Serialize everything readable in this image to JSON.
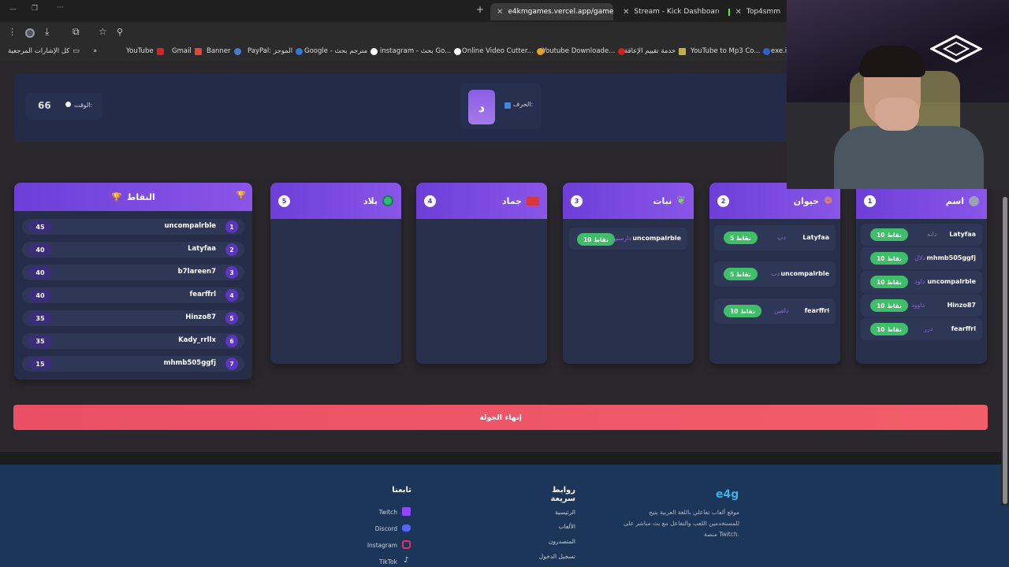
{
  "browser": {
    "tabs": [
      {
        "title": "e4kmgames.vercel.app/games/",
        "active": true
      },
      {
        "title": "Stream - Kick Dashboard",
        "active": false
      },
      {
        "title": "Top4smm",
        "active": false
      }
    ],
    "bookmarks": [
      "كل الإشارات المرجعية",
      "YouTube",
      "Gmail",
      "Banner",
      "PayPal: الموجز",
      "Google - مترجم بحث",
      "instagram - بحث Go...",
      "Online Video Cutter...",
      "Youtube Downloade...",
      "خدمة تقييم الإعاقة",
      "YouTube to Mp3 Co...",
      "exe.io"
    ]
  },
  "game": {
    "timer_label": "الوقت:",
    "timer_value": "66",
    "letter_label": "الحرف:",
    "letter": "د",
    "categories": [
      {
        "index": "1",
        "title": "اسم",
        "icon": "person-icon",
        "answers": [
          {
            "player": "Latyfaa",
            "word": "دانه",
            "points": "10 نقاط"
          },
          {
            "player": "mhmb505ggfj",
            "word": "دلال",
            "points": "10 نقاط"
          },
          {
            "player": "uncompalrble",
            "word": "داود",
            "points": "10 نقاط"
          },
          {
            "player": "Hinzo87",
            "word": "داوود",
            "points": "10 نقاط"
          },
          {
            "player": "fearffrl",
            "word": "درر",
            "points": "10 نقاط"
          }
        ]
      },
      {
        "index": "2",
        "title": "حيوان",
        "icon": "paw-icon",
        "answers": [
          {
            "player": "Latyfaa",
            "word": "دب",
            "points": "5 نقاط"
          },
          {
            "player": "uncompalrble",
            "word": "دب",
            "points": "5 نقاط"
          },
          {
            "player": "fearffrl",
            "word": "دلفين",
            "points": "10 نقاط"
          }
        ]
      },
      {
        "index": "3",
        "title": "نبات",
        "icon": "leaf-icon",
        "answers": [
          {
            "player": "uncompalrble",
            "word": "دارسين",
            "points": "10 نقاط"
          }
        ]
      },
      {
        "index": "4",
        "title": "جماد",
        "icon": "toolbox-icon",
        "answers": []
      },
      {
        "index": "5",
        "title": "بلاد",
        "icon": "globe-icon",
        "answers": []
      }
    ],
    "scores_title": "النقاط",
    "scores": [
      {
        "rank": "1",
        "name": "uncompalrble",
        "points": "45"
      },
      {
        "rank": "2",
        "name": "Latyfaa",
        "points": "40"
      },
      {
        "rank": "3",
        "name": "b7lareen7",
        "points": "40"
      },
      {
        "rank": "4",
        "name": "fearffrl",
        "points": "40"
      },
      {
        "rank": "5",
        "name": "Hinzo87",
        "points": "35"
      },
      {
        "rank": "6",
        "name": "Kady_rrllx",
        "points": "35"
      },
      {
        "rank": "7",
        "name": "mhmb505ggfj",
        "points": "15"
      }
    ],
    "end_round": "إنهاء الجولة"
  },
  "footer": {
    "brand": "e4g",
    "description_1": "موقع ألعاب تفاعلي باللغة العربية يتيح",
    "description_2": "للمستخدمين اللعب والتفاعل مع بث مباشر على",
    "description_3": "منصة Twitch.",
    "quick_links_title": "روابط سريعة",
    "quick_links": [
      "الرئيسية",
      "الألعاب",
      "المتصدرون",
      "تسجيل الدخول"
    ],
    "follow_title": "تابعنا",
    "social": [
      "Twitch",
      "Discord",
      "Instagram",
      "TikTok"
    ]
  },
  "colors": {
    "accent": "#7c4ae0",
    "green": "#3fbd68",
    "red": "#ef5466",
    "footer": "#1b3658"
  }
}
